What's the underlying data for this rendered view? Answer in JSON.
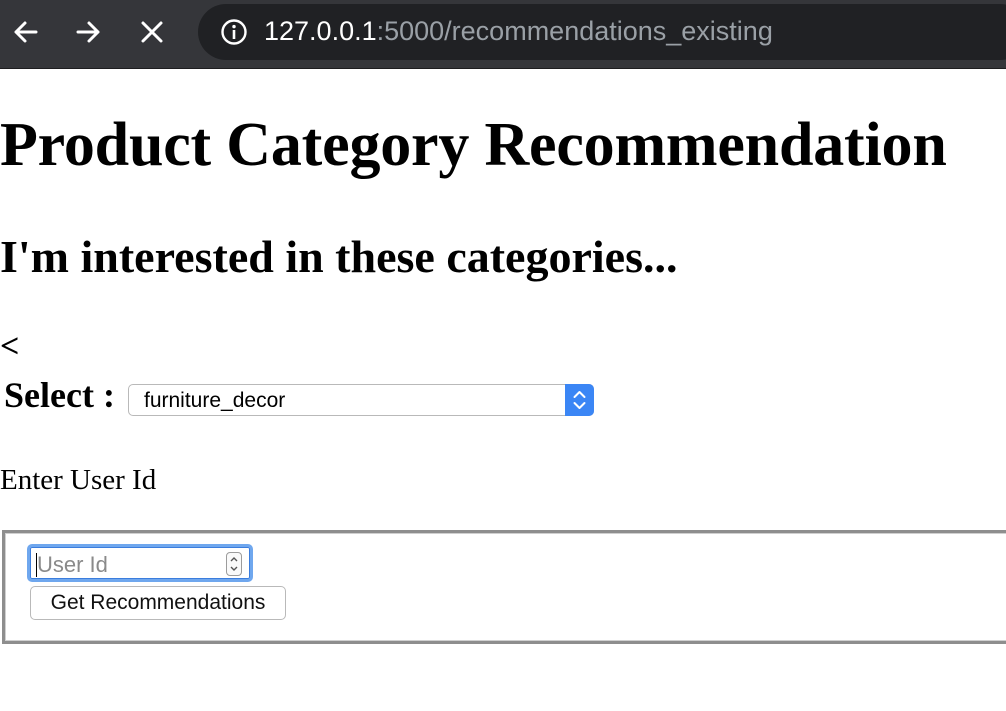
{
  "browser": {
    "url_host": "127.0.0.1",
    "url_rest": ":5000/recommendations_existing",
    "back_icon": "back-arrow-icon",
    "forward_icon": "forward-arrow-icon",
    "stop_icon": "close-icon",
    "info_icon": "info-icon"
  },
  "page": {
    "title": "Product Category Recommendation",
    "subtitle": "I'm interested in these categories...",
    "stray_char": "<",
    "select_label": "Select :",
    "select_value": "furniture_decor",
    "enter_label": "Enter User Id",
    "userid_placeholder": "User Id",
    "submit_label": "Get Recommendations"
  },
  "colors": {
    "toolbar": "#35363a",
    "urlbar": "#202124",
    "focus_ring": "#6fa7ee",
    "select_accent": "#3b86f5"
  }
}
